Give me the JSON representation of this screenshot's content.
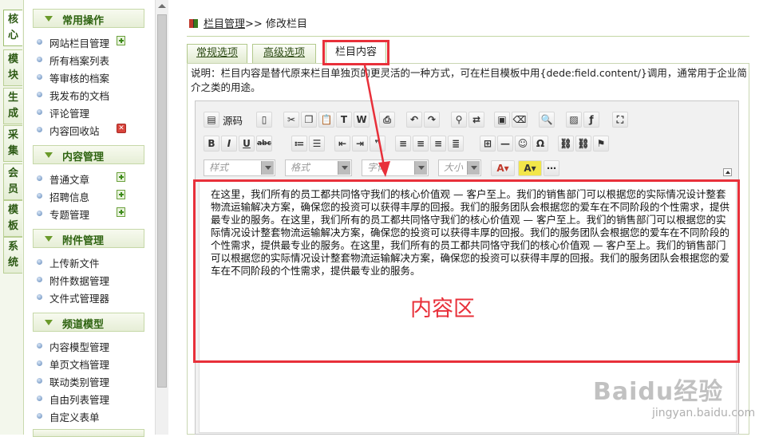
{
  "vertical_tabs": [
    {
      "label": "核心"
    },
    {
      "label": "模块"
    },
    {
      "label": "生成"
    },
    {
      "label": "采集"
    },
    {
      "label": "会员"
    },
    {
      "label": "模板"
    },
    {
      "label": "系统"
    }
  ],
  "menu_groups": [
    {
      "title": "常用操作",
      "items": [
        {
          "label": "网站栏目管理"
        },
        {
          "label": "所有档案列表"
        },
        {
          "label": "等审核的档案"
        },
        {
          "label": "我发布的文档"
        },
        {
          "label": "评论管理"
        },
        {
          "label": "内容回收站"
        }
      ]
    },
    {
      "title": "内容管理",
      "items": [
        {
          "label": "普通文章"
        },
        {
          "label": "招聘信息"
        },
        {
          "label": "专题管理"
        }
      ]
    },
    {
      "title": "附件管理",
      "items": [
        {
          "label": "上传新文件"
        },
        {
          "label": "附件数据管理"
        },
        {
          "label": "文件式管理器"
        }
      ]
    },
    {
      "title": "频道模型",
      "items": [
        {
          "label": "内容模型管理"
        },
        {
          "label": "单页文档管理"
        },
        {
          "label": "联动类别管理"
        },
        {
          "label": "自由列表管理"
        },
        {
          "label": "自定义表单"
        }
      ]
    }
  ],
  "breadcrumb": {
    "link": "栏目管理",
    "sep": ">> ",
    "current": "修改栏目"
  },
  "tabs": [
    {
      "label": "常规选项"
    },
    {
      "label": "高级选项"
    },
    {
      "label": "栏目内容"
    }
  ],
  "description": "说明：栏目内容是替代原来栏目单独页的更灵活的一种方式，可在栏目模板中用{dede:field.content/}调用，通常用于企业简介之类的用途。",
  "editor": {
    "source_label": "源码",
    "style_placeholder": "样式",
    "format_placeholder": "格式",
    "font_placeholder": "字体",
    "size_placeholder": "大小",
    "content": "在这里，我们所有的员工都共同恪守我们的核心价值观 — 客户至上。我们的销售部门可以根据您的实际情况设计整套物流运输解决方案，确保您的投资可以获得丰厚的回报。我们的服务团队会根据您的爱车在不同阶段的个性需求，提供最专业的服务。在这里，我们所有的员工都共同恪守我们的核心价值观 — 客户至上。我们的销售部门可以根据您的实际情况设计整套物流运输解决方案，确保您的投资可以获得丰厚的回报。我们的服务团队会根据您的爱车在不同阶段的个性需求，提供最专业的服务。在这里，我们所有的员工都共同恪守我们的核心价值观 — 客户至上。我们的销售部门可以根据您的实际情况设计整套物流运输解决方案，确保您的投资可以获得丰厚的回报。我们的服务团队会根据您的爱车在不同阶段的个性需求，提供最专业的服务。"
  },
  "annotation": {
    "label": "内容区",
    "color": "#e8303a"
  },
  "watermark": {
    "main": "Baidu经验",
    "sub": "jingyan.baidu.com"
  },
  "colors": {
    "green_dark": "#2e6310",
    "accent_red": "#e8303a"
  }
}
